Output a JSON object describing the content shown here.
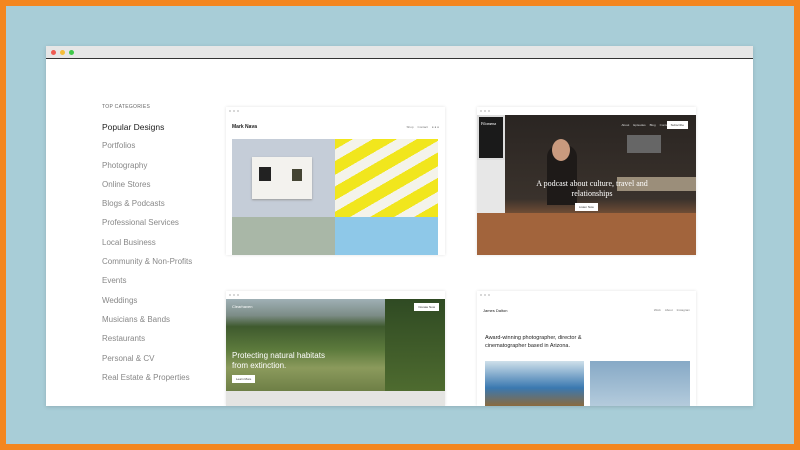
{
  "sidebar": {
    "heading": "TOP CATEGORIES",
    "items": [
      "Popular Designs",
      "Portfolios",
      "Photography",
      "Online Stores",
      "Blogs & Podcasts",
      "Professional Services",
      "Local Business",
      "Community & Non-Profits",
      "Events",
      "Weddings",
      "Musicians & Bands",
      "Restaurants",
      "Personal & CV",
      "Real Estate & Properties"
    ]
  },
  "templates": [
    {
      "site_name": "Mark Nava",
      "nav": [
        "Shop",
        "Contact"
      ]
    },
    {
      "site_name": "Filomena",
      "nav": [
        "About",
        "Episodes",
        "Blog",
        "Contact"
      ],
      "headline": "A podcast about culture, travel and relationships",
      "cta": "Listen Now",
      "top_button": "Subscribe"
    },
    {
      "site_name": "Clearhaven",
      "headline": "Protecting natural habitats from extinction.",
      "cta": "Learn More",
      "top_button": "Donate Now"
    },
    {
      "site_name": "James Dalton",
      "nav": [
        "Work",
        "About",
        "Instagram"
      ],
      "headline": "Award-winning photographer, director & cinematographer based in Arizona."
    }
  ]
}
